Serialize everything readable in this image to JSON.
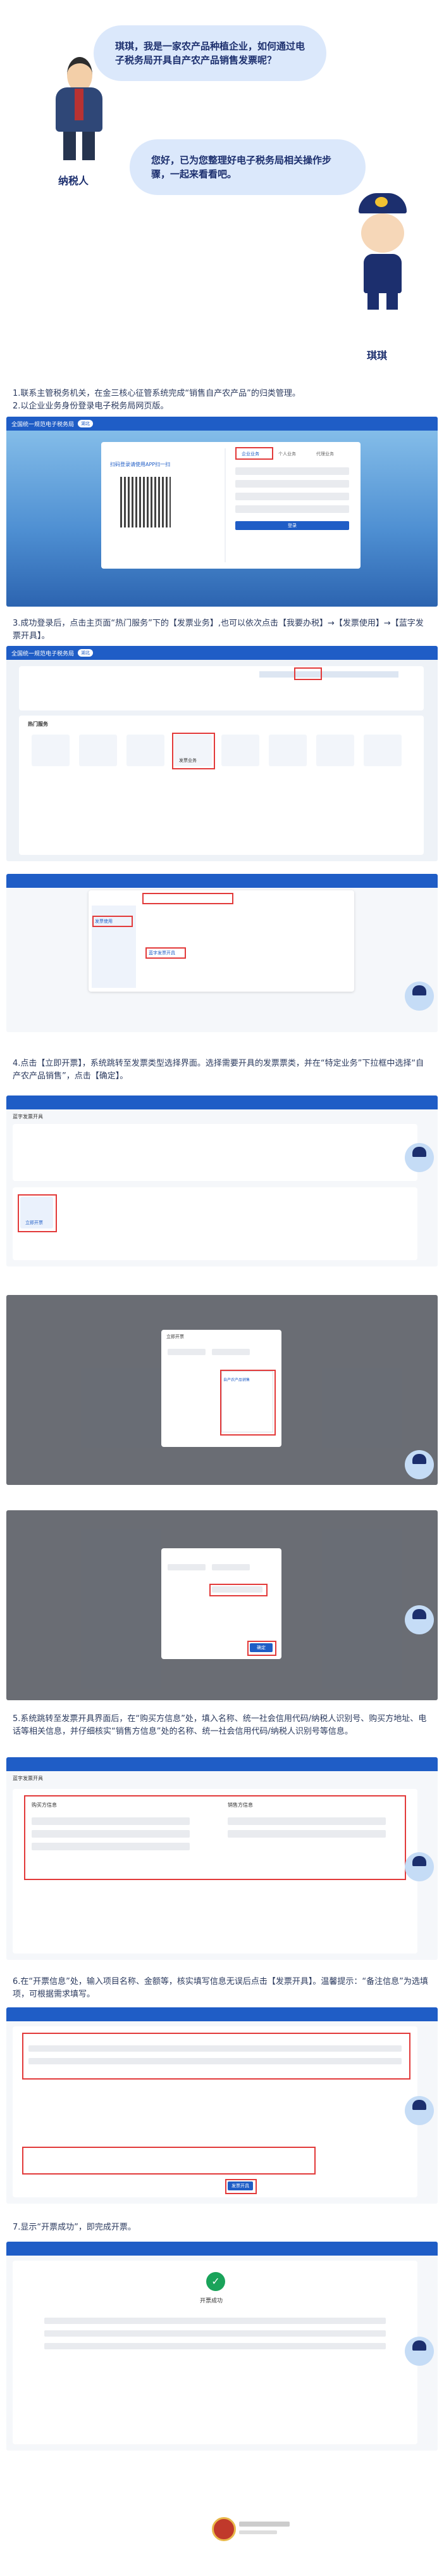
{
  "bubbles": {
    "taxpayer_question": "琪琪，我是一家农产品种植企业，如何通过电子税务局开具自产农产品销售发票呢？",
    "qiqi_answer": "您好，已为您整理好电子税务局相关操作步骤，一起来看看吧。"
  },
  "characters": {
    "taxpayer_name": "纳税人",
    "qiqi_name": "琪琪"
  },
  "steps": {
    "s1": "1.联系主管税务机关，在金三核心征管系统完成“销售自产农产品”的归类管理。",
    "s2": "2.以企业业务身份登录电子税务局网页版。",
    "s3": "3.成功登录后，点击主页面“热门服务”下的【发票业务】,也可以依次点击【我要办税】→【发票使用】→【蓝字发票开具】。",
    "s4": "4.点击【立即开票】，系统跳转至发票类型选择界面。选择需要开具的发票票类，并在“特定业务”下拉框中选择“自产农产品销售”，点击【确定】。",
    "s5": "5.系统跳转至发票开具界面后，在“购买方信息”处，填入名称、统一社会信用代码/纳税人识别号、购买方地址、电话等相关信息，并仔细核实“销售方信息”处的名称、统一社会信用代码/纳税人识别号等信息。",
    "s6": "6.在“开票信息”处，输入项目名称、金额等，核实填写信息无误后点击【发票开具】。温馨提示：“备注信息”为选填项，可根据需求填写。",
    "s7": "7.显示“开票成功”，即完成开票。"
  },
  "login": {
    "title_bar": "全国统一规范电子税务局",
    "region_pill": "湖北",
    "qr_title": "扫码登录请使用APP扫一扫",
    "tab_enterprise": "企业业务",
    "tab_personal": "个人业务",
    "tab_agent": "代理业务",
    "login_button": "登录"
  },
  "portal": {
    "title_bar": "全国统一规范电子税务局",
    "region_pill": "湖北",
    "hot_services": "热门服务",
    "invoice_business": "发票业务"
  },
  "menu": {
    "invoice_use": "发票使用",
    "blue_invoice": "蓝字发票开具"
  },
  "issue": {
    "title": "蓝字发票开具",
    "issue_now": "立即开票"
  },
  "dialog": {
    "title": "立即开票",
    "special_business": "自产农产品销售",
    "confirm": "确定"
  },
  "form": {
    "title": "蓝字发票开具",
    "buyer_info": "购买方信息",
    "seller_info": "销售方信息",
    "issue_button": "发票开具"
  },
  "success": {
    "title": "开票成功"
  },
  "colors": {
    "brand_blue": "#1f5dc6",
    "highlight_red": "#e23a3a",
    "success_green": "#1aa35a"
  }
}
